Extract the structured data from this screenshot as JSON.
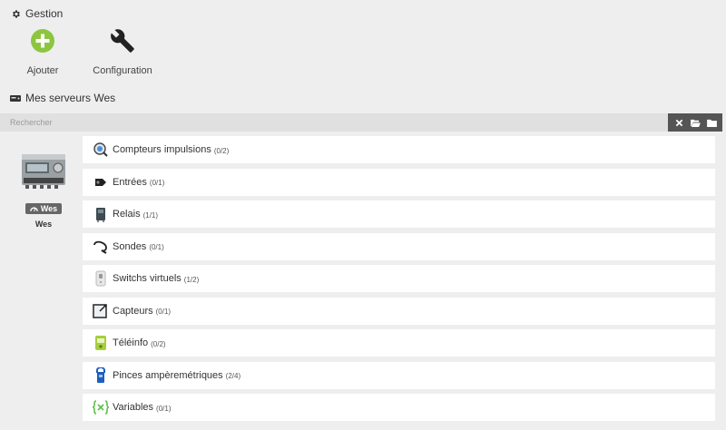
{
  "gestion": {
    "title": "Gestion",
    "actions": [
      {
        "label": "Ajouter"
      },
      {
        "label": "Configuration"
      }
    ]
  },
  "servers": {
    "title": "Mes serveurs Wes",
    "search_placeholder": "Rechercher",
    "items": [
      {
        "badge": "Wes",
        "name": "Wes"
      }
    ]
  },
  "categories": [
    {
      "label": "Compteurs impulsions",
      "count": "(0/2)",
      "icon": "pulse-counter-icon"
    },
    {
      "label": "Entrées",
      "count": "(0/1)",
      "icon": "input-icon"
    },
    {
      "label": "Relais",
      "count": "(1/1)",
      "icon": "relay-icon"
    },
    {
      "label": "Sondes",
      "count": "(0/1)",
      "icon": "probe-icon"
    },
    {
      "label": "Switchs virtuels",
      "count": "(1/2)",
      "icon": "virtual-switch-icon"
    },
    {
      "label": "Capteurs",
      "count": "(0/1)",
      "icon": "sensor-icon"
    },
    {
      "label": "Téléinfo",
      "count": "(0/2)",
      "icon": "teleinfo-icon"
    },
    {
      "label": "Pinces ampèremétriques",
      "count": "(2/4)",
      "icon": "clamp-meter-icon"
    },
    {
      "label": "Variables",
      "count": "(0/1)",
      "icon": "variables-icon"
    }
  ],
  "colors": {
    "add_green": "#8cc63f",
    "toolbar_dark": "#555555",
    "badge_gray": "#666666"
  }
}
